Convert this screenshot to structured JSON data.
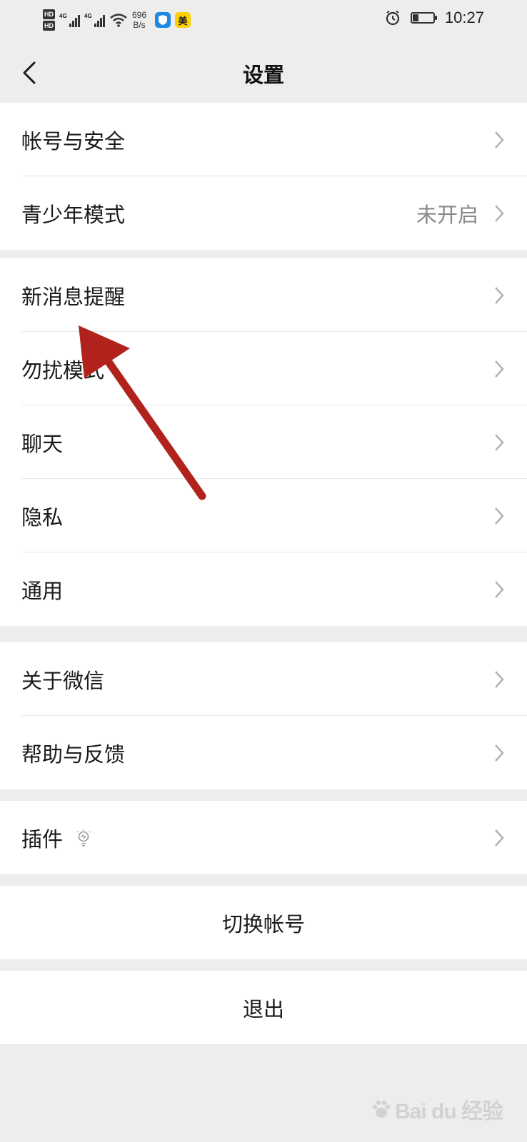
{
  "status_bar": {
    "sim1": "HD",
    "sim2": "HD",
    "network1": "4G",
    "network2": "4G",
    "net_speed_value": "696",
    "net_speed_unit": "B/s",
    "meituan_badge": "美",
    "time": "10:27",
    "battery_level": 0.3,
    "icons": [
      "hd-icon",
      "signal-icon",
      "wifi-icon",
      "security-app-icon",
      "meituan-app-icon",
      "alarm-icon",
      "battery-icon"
    ]
  },
  "nav": {
    "title": "设置",
    "back_icon": "chevron-left-icon"
  },
  "groups": [
    {
      "items": [
        {
          "label": "帐号与安全"
        },
        {
          "label": "青少年模式",
          "value": "未开启"
        }
      ]
    },
    {
      "items": [
        {
          "label": "新消息提醒"
        },
        {
          "label": "勿扰模式"
        },
        {
          "label": "聊天"
        },
        {
          "label": "隐私"
        },
        {
          "label": "通用"
        }
      ]
    },
    {
      "items": [
        {
          "label": "关于微信"
        },
        {
          "label": "帮助与反馈"
        }
      ]
    },
    {
      "items": [
        {
          "label": "插件"
        }
      ]
    }
  ],
  "buttons": {
    "switch_account": "切换帐号",
    "logout": "退出"
  },
  "annotation": {
    "color": "#b2221c",
    "points_to": "新消息提醒"
  },
  "watermark": {
    "text": "Bai du 经验",
    "icon": "baidu-paw-icon"
  },
  "colors": {
    "background": "#ededed",
    "card": "#ffffff",
    "chevron": "#b2b2b2",
    "value_text": "#888888"
  }
}
